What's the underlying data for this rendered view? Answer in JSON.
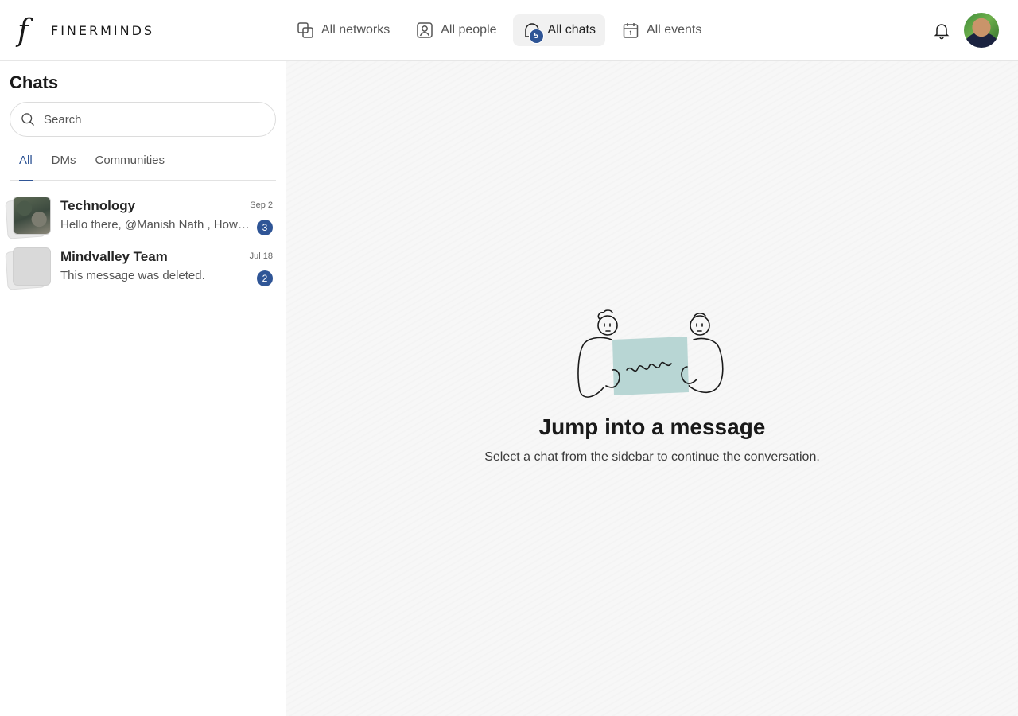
{
  "brand": {
    "name": "FINERMINDS",
    "mark": "f"
  },
  "nav": {
    "items": [
      {
        "label": "All networks",
        "icon": "networks-icon"
      },
      {
        "label": "All people",
        "icon": "person-icon"
      },
      {
        "label": "All chats",
        "icon": "chat-icon",
        "badge": "5",
        "active": true
      },
      {
        "label": "All events",
        "icon": "calendar-icon"
      }
    ]
  },
  "header": {
    "notification_icon": "bell-icon",
    "avatar_icon": "user-avatar"
  },
  "sidebar": {
    "title": "Chats",
    "search": {
      "placeholder": "Search",
      "value": ""
    },
    "tabs": [
      {
        "label": "All",
        "active": true
      },
      {
        "label": "DMs"
      },
      {
        "label": "Communities"
      }
    ],
    "chats": [
      {
        "name": "Technology",
        "date": "Sep 2",
        "preview": "Hello there, @Manish Nath , How are you doing today?",
        "unread": "3"
      },
      {
        "name": "Mindvalley Team",
        "date": "Jul 18",
        "preview": "This message was deleted.",
        "unread": "2"
      }
    ]
  },
  "empty_state": {
    "title": "Jump into a message",
    "subtitle": "Select a chat from the sidebar to continue the conversation."
  },
  "colors": {
    "accent": "#2f5596",
    "card": "#b8d6d4",
    "background": "#f7f7f7"
  }
}
